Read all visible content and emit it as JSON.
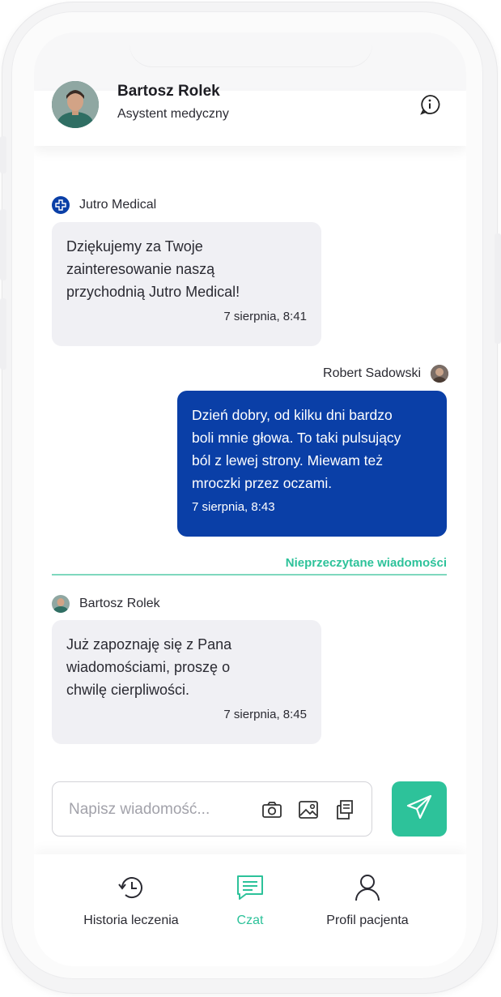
{
  "header": {
    "name": "Bartosz Rolek",
    "role": "Asystent medyczny",
    "info_icon": "info-icon"
  },
  "messages": [
    {
      "sender": "Jutro Medical",
      "direction": "in",
      "text": "Dziękujemy za Twoje\nzainteresowanie naszą\nprzychodnią Jutro Medical!",
      "time": "7 sierpnia, 8:41"
    },
    {
      "sender": "Robert Sadowski",
      "direction": "out",
      "text": "Dzień dobry, od kilku dni bardzo\nboli mnie głowa. To taki pulsujący\nból z lewej strony. Miewam też\nmroczki przez oczami.",
      "time": "7 sierpnia, 8:43"
    },
    {
      "sender": "Bartosz Rolek",
      "direction": "in",
      "text": "Już zapoznaję się z Pana\nwiadomościami, proszę o\nchwilę cierpliwości.",
      "time": "7 sierpnia, 8:45"
    }
  ],
  "unread_divider": "Nieprzeczytane wiadomości",
  "composer": {
    "placeholder": "Napisz wiadomość...",
    "value": "",
    "tools": [
      "camera-icon",
      "image-icon",
      "document-icon"
    ],
    "send_icon": "send-icon"
  },
  "nav": {
    "items": [
      {
        "label": "Historia leczenia",
        "icon": "history-icon",
        "active": false
      },
      {
        "label": "Czat",
        "icon": "chat-icon",
        "active": true
      },
      {
        "label": "Profil pacjenta",
        "icon": "user-icon",
        "active": false
      }
    ]
  },
  "colors": {
    "accent": "#2dc29a",
    "outgoing_bubble": "#0a3fa7",
    "incoming_bubble": "#f0f0f4"
  }
}
